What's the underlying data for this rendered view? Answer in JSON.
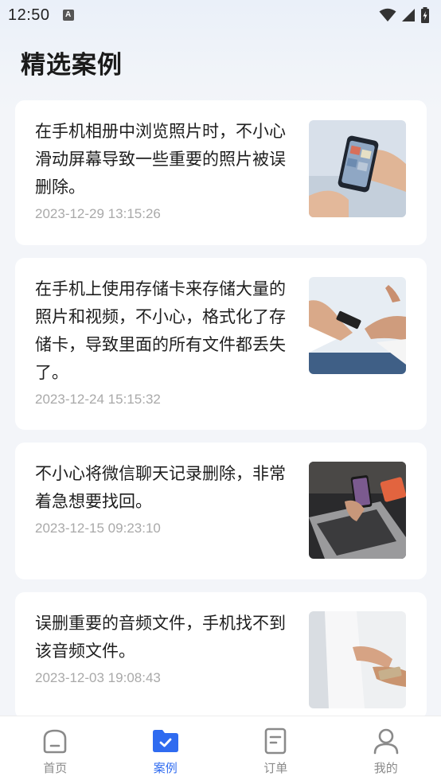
{
  "status_bar": {
    "time": "12:50",
    "notification_icon": "A"
  },
  "page_title": "精选案例",
  "cases": [
    {
      "text": "在手机相册中浏览照片时，不小心滑动屏幕导致一些重要的照片被误删除。",
      "date": "2023-12-29 13:15:26",
      "image": "phone-gallery-photo"
    },
    {
      "text": "在手机上使用存储卡来存储大量的照片和视频，不小心，格式化了存储卡，导致里面的所有文件都丢失了。",
      "date": "2023-12-24 15:15:32",
      "image": "handing-phone-photo"
    },
    {
      "text": "不小心将微信聊天记录删除，非常着急想要找回。",
      "date": "2023-12-15 09:23:10",
      "image": "laptop-phone-photo"
    },
    {
      "text": "误删重要的音频文件，手机找不到该音频文件。",
      "date": "2023-12-03 19:08:43",
      "image": "phone-hand-photo"
    }
  ],
  "tabs": [
    {
      "label": "首页",
      "icon": "home-icon"
    },
    {
      "label": "案例",
      "icon": "folder-check-icon",
      "active": true
    },
    {
      "label": "订单",
      "icon": "order-icon"
    },
    {
      "label": "我的",
      "icon": "user-icon"
    }
  ],
  "colors": {
    "accent": "#2f6bf0",
    "background": "#f3f5f9",
    "date_text": "#a9a9a9"
  }
}
